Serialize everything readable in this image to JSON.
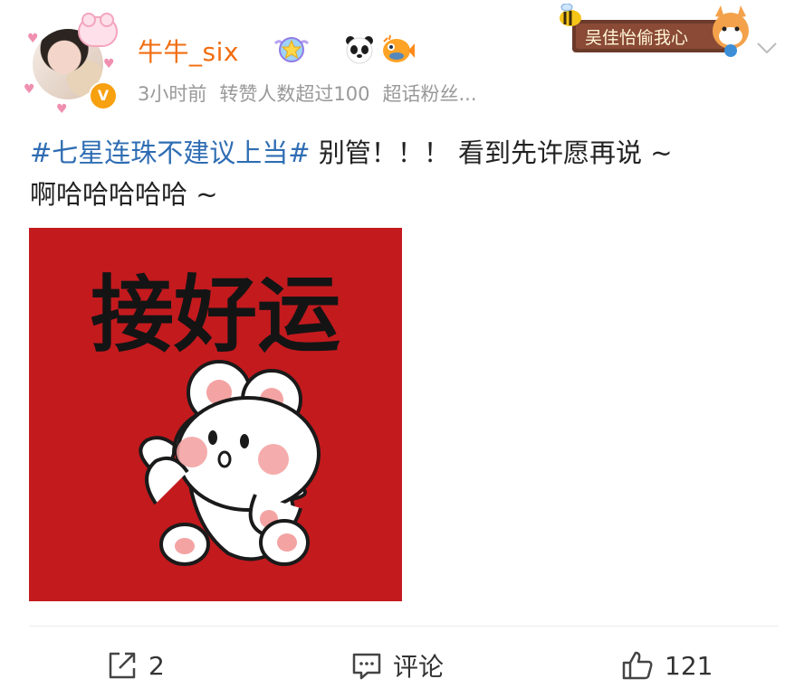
{
  "user": {
    "name": "牛牛_six",
    "avatar_icon": "avatar-girl-with-bear-frame",
    "verified_badge": "V",
    "badges": [
      "star-member-icon",
      "panda-icon",
      "pufferfish-icon"
    ]
  },
  "meta": {
    "time": "3小时前",
    "repost_note": "转赞人数超过100",
    "source": "超话粉丝..."
  },
  "sticker": {
    "text": "吴佳怡偷我心",
    "icons": [
      "bee-icon",
      "shiba-dog-icon"
    ]
  },
  "post": {
    "topic": "#七星连珠不建议上当#",
    "body_line1": " 别管！！！ 看到先许愿再说 ~",
    "body_line2": "啊哈哈哈哈哈 ~",
    "image": {
      "caption_text": "接好运",
      "background": "#c31a1e",
      "subject": "white-bear-icon"
    }
  },
  "actions": {
    "repost_count": "2",
    "comment_label": "评论",
    "like_count": "121"
  },
  "colors": {
    "username": "#f26d10",
    "topic": "#2f6db3",
    "meta": "#999999",
    "verified": "#f7a010"
  }
}
